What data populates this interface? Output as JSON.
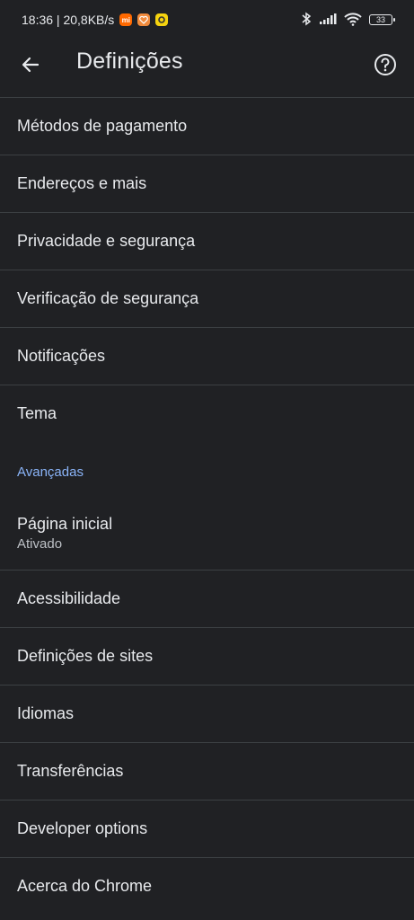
{
  "status_bar": {
    "time_speed": "18:36 | 20,8KB/s",
    "app_icon_1": "mi-icon",
    "app_icon_2": "heart-app-icon",
    "app_icon_3": "ring-app-icon",
    "bluetooth_icon": "bluetooth-icon",
    "signal_icon": "signal-icon",
    "wifi_icon": "wifi-icon",
    "battery_level": "33"
  },
  "app_bar": {
    "back_icon": "arrow-back-icon",
    "title": "Definições",
    "help_icon": "help-circle-icon"
  },
  "settings": {
    "basic_items": [
      {
        "label": "Métodos de pagamento"
      },
      {
        "label": "Endereços e mais"
      },
      {
        "label": "Privacidade e segurança"
      },
      {
        "label": "Verificação de segurança"
      },
      {
        "label": "Notificações"
      },
      {
        "label": "Tema"
      }
    ],
    "advanced_header": "Avançadas",
    "advanced_items": [
      {
        "label": "Página inicial",
        "summary": "Ativado"
      },
      {
        "label": "Acessibilidade"
      },
      {
        "label": "Definições de sites"
      },
      {
        "label": "Idiomas"
      },
      {
        "label": "Transferências"
      },
      {
        "label": "Developer options"
      },
      {
        "label": "Acerca do Chrome"
      }
    ]
  },
  "colors": {
    "background": "#202124",
    "text": "#e8eaed",
    "divider": "#3c4043",
    "accent": "#8ab4f8",
    "secondary_text": "#bdc1c6"
  }
}
